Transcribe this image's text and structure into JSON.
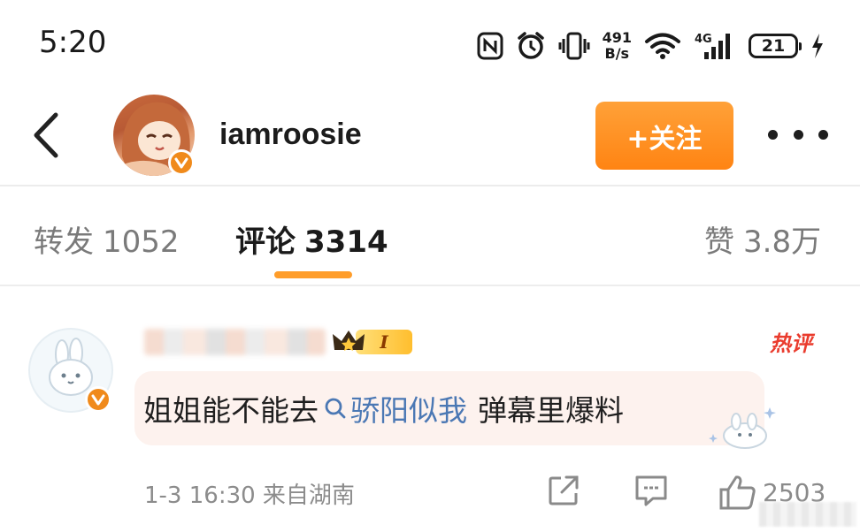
{
  "status_bar": {
    "time": "5:20",
    "net_speed_value": "491",
    "net_speed_unit": "B/s",
    "signal_label": "4G",
    "battery_level": "21",
    "icons": [
      "nfc-icon",
      "alarm-icon",
      "vibrate-icon",
      "wifi-icon",
      "cellular-signal-icon",
      "battery-icon",
      "charging-icon"
    ]
  },
  "header": {
    "username": "iamroosie",
    "follow_label": "+关注",
    "verified": true
  },
  "tabs": [
    {
      "label": "转发",
      "count": "1052",
      "active": false
    },
    {
      "label": "评论",
      "count": "3314",
      "active": true
    },
    {
      "label": "赞",
      "count": "3.8万",
      "active": false
    }
  ],
  "comment": {
    "username_blurred": true,
    "vip_level": "I",
    "hot_label": "热评",
    "text_before": "姐姐能不能去",
    "topic": "骄阳似我",
    "text_after": "弹幕里爆料",
    "meta": "1-3 16:30 来自湖南",
    "like_count": "2503"
  },
  "colors": {
    "accent_orange": "#ff8c1a",
    "link_blue": "#4b78b4",
    "hot_red": "#ea3c2e",
    "bubble_bg": "#fdf2ee"
  }
}
